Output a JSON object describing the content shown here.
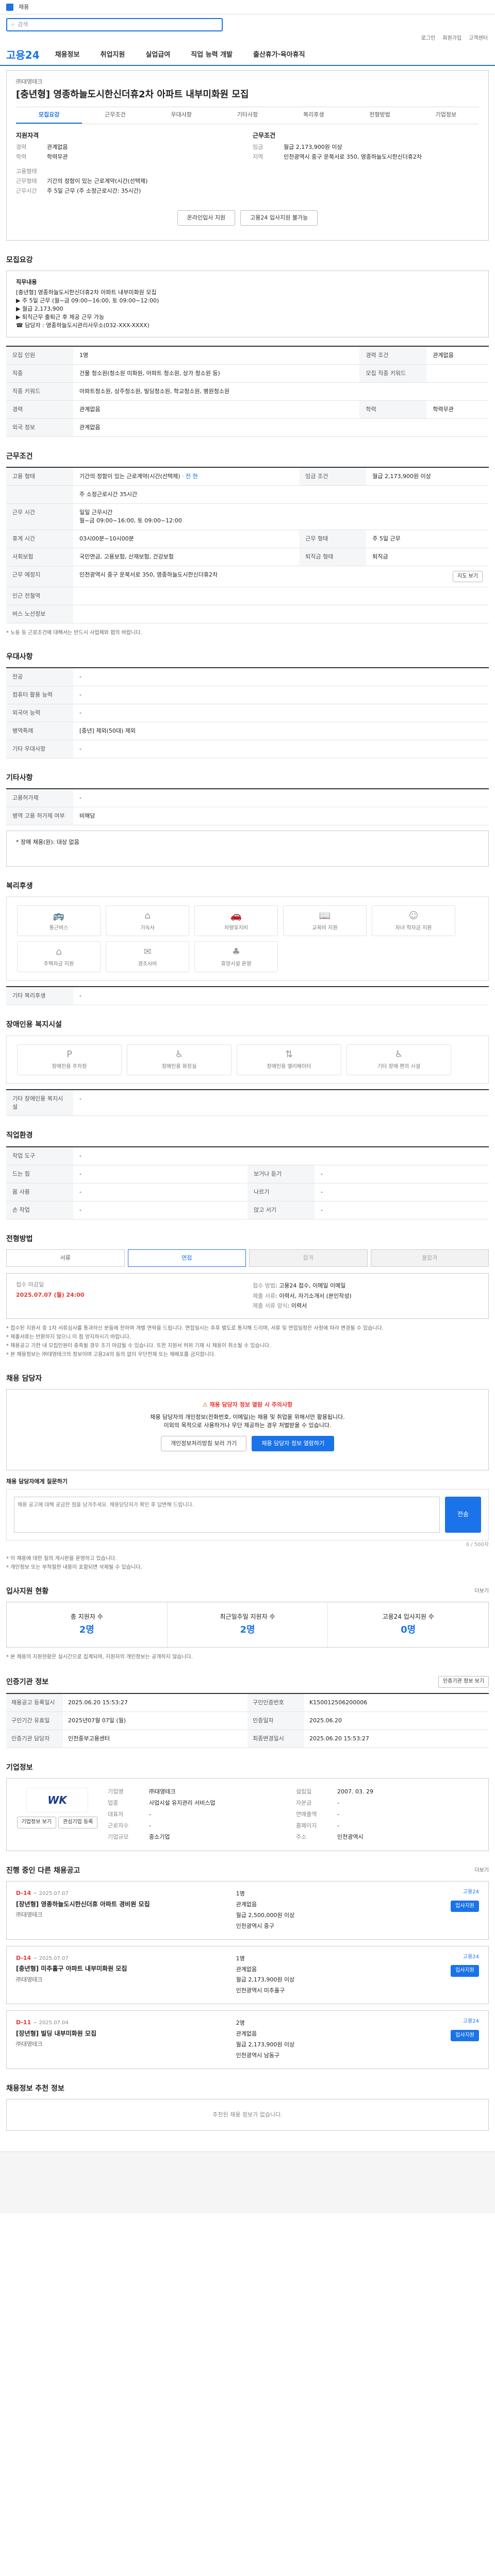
{
  "header": {
    "top_left": "채용",
    "search_placeholder": "검색",
    "util": [
      "로그인",
      "회원가입",
      "고객센터"
    ],
    "brand": "고용24",
    "menu": [
      "채용정보",
      "취업지원",
      "실업급여",
      "직업 능력 개발",
      "출산휴가·육아휴직"
    ]
  },
  "title": {
    "company": "㈜대영테크",
    "heading": "[충년형] 영종하늘도시한신더휴2차 아파트 내부미화원 모집",
    "tabs": [
      "모집요강",
      "근무조건",
      "우대사항",
      "기타사항",
      "복리후생",
      "전형방법",
      "기업정보"
    ],
    "active_tab": 0,
    "left_head": "지원자격",
    "right_head": "근무조건",
    "left_kv": [
      {
        "k": "경력",
        "v": "관계없음"
      },
      {
        "k": "학력",
        "v": "학력무관"
      }
    ],
    "right_kv": [
      {
        "k": "임금",
        "v": "월급 2,173,900원 이상"
      },
      {
        "k": "지역",
        "v": "인천광역시 중구 운북서로 350, 영종하늘도시한신더휴2차"
      }
    ],
    "left_kv2": [
      {
        "k": "고용형태",
        "v": ""
      },
      {
        "k": "근무형태",
        "v": "기간의 정함이 있는 근로계약(시간(선택제)"
      },
      {
        "k": "근무시간",
        "v": "주 5일 근무 (주 소정근로시간: 35시간)"
      }
    ],
    "apply_btn": "온라인입사 지원",
    "scrap_btn": "고용24 입사지원 불가능"
  },
  "recruit": {
    "title": "모집요강",
    "desc": [
      "직무내용",
      "[충년형] 영종하늘도시한신더휴2차 아파트 내부미화원 모집",
      "▶ 주 5일 근무 (월~금 09:00~16:00, 토 09:00~12:00)",
      "▶ 월급 2,173,900",
      "▶ 퇴직근무 출퇴근 후 제공 근무 가능",
      "☎ 담당자 : 영종하늘도시관리사무소(032-XXX-XXXX)"
    ],
    "rows": [
      {
        "k": "모집 인원",
        "v": "1명",
        "k2": "경력 조건",
        "v2": "관계없음"
      },
      {
        "k": "직종",
        "v": "건물 청소원(청소원 미화원, 아파트 청소원, 상가 청소원 등)",
        "k2": "모집 직종 키워드",
        "v2": ""
      },
      {
        "k": "직종 키워드",
        "v": "아파트청소원, 상주청소원, 빌딩청소원, 학교청소원, 병원청소원",
        "k2": "",
        "v2": ""
      },
      {
        "k": "경력",
        "v": "관계없음",
        "k2": "학력",
        "v2": "학력무관"
      },
      {
        "k": "외국 정보",
        "v": "관계없음",
        "k2": "",
        "v2": ""
      }
    ]
  },
  "conditions": {
    "title": "근무조건",
    "rows": [
      {
        "k": "고용 형태",
        "v": "기간의 정함이 있는 근로계약(시간(선택제)",
        "v_extra": "· 전 현",
        "k2": "임금 조건",
        "v2": "월급 2,173,900원 이상"
      },
      {
        "k": "",
        "v": "주 소정근로시간 35시간",
        "v_extra": "",
        "k2": "",
        "v2": ""
      },
      {
        "k": "근무 시간",
        "v": "일일 근무시간",
        "v_extra": "월~금 09:00~16:00, 토 09:00~12:00",
        "k2": "",
        "v2": ""
      },
      {
        "k": "휴게 시간",
        "v": "03시00분~10시00분",
        "v_extra": "",
        "k2": "근무 형태",
        "v2": "주 5일 근무"
      },
      {
        "k": "사회보험",
        "v": "국민연금, 고용보험, 산재보험, 건강보험",
        "v_extra": "",
        "k2": "퇴직금 형태",
        "v2": "퇴직금"
      },
      {
        "k": "근무 예정지",
        "v": "인천광역시 중구 운북서로 350, 영종하늘도시한신더휴2차",
        "v_extra": "",
        "k2": "",
        "v2": ""
      },
      {
        "k": "인근 전철역",
        "v": "",
        "v_extra": "",
        "k2": "",
        "v2": ""
      },
      {
        "k": "버스 노선정보",
        "v": "",
        "v_extra": "",
        "k2": "",
        "v2": ""
      }
    ],
    "map_btn": "지도 보기",
    "note": "* 노동 등 근로조건에 대해서는 반드시 사업체와 협의 바랍니다."
  },
  "preference": {
    "title": "우대사항",
    "rows": [
      {
        "k": "전공",
        "v": "-"
      },
      {
        "k": "컴퓨터 활용 능력",
        "v": "-"
      },
      {
        "k": "외국어 능력",
        "v": "-"
      },
      {
        "k": "병역특례",
        "v": "[중년] 제외(50대) 제외"
      },
      {
        "k": "기타 우대사항",
        "v": "-"
      }
    ]
  },
  "etc": {
    "title": "기타사항",
    "rows": [
      {
        "k": "고용허가제",
        "v": "-"
      },
      {
        "k": "병역 고용 허가제 여부",
        "v": "비해당"
      }
    ],
    "extra": "* 장애 채용(원): 대상 없음"
  },
  "welfare": {
    "title": "복리후생",
    "items": [
      "통근버스",
      "기숙사",
      "차량유지비",
      "교육비 지원",
      "자녀 학자금 지원",
      "주택자금 지원",
      "경조사비",
      "휴양시설 운영"
    ],
    "other_label": "기타 복리후생",
    "other_value": "-"
  },
  "disabled": {
    "title": "장애인용 복지시설",
    "items": [
      "장애인용 주차장",
      "장애인용 화장실",
      "장애인용 엘리베이터",
      "기타 장애 편의 시설"
    ],
    "other_label": "기타 장애인용 복지시설",
    "other_value": "-"
  },
  "selection": {
    "title": "직업환경",
    "rows": [
      {
        "k": "작업 도구",
        "v": "-",
        "k2": "",
        "v2": ""
      },
      {
        "k": "드는 힘",
        "v": "-",
        "k2": "보거나 듣기",
        "v2": "-"
      },
      {
        "k": "몸 사용",
        "v": "-",
        "k2": "나르기",
        "v2": "-"
      },
      {
        "k": "손 작업",
        "v": "-",
        "k2": "앉고 서기",
        "v2": "-"
      }
    ]
  },
  "process": {
    "title": "전형방법",
    "steps": [
      "서류",
      "면접",
      "합격",
      "불합격"
    ],
    "left_head": "접수 마감일",
    "deadline": "2025.07.07 (월) 24:00",
    "receipt_k": "접수 방법",
    "receipt_v": "고용24 접수, 이메일 이메일",
    "docs_k": "제출 서류",
    "docs_v": "이력서, 자기소개서 (본인작성)",
    "form_k": "제출 서류 양식",
    "form_v": "이력서",
    "notes": [
      "* 접수된 지원서 중 1차 서류심사를 통과하신 분들에 한하여 개별 연락을 드립니다. 면접일시는 추후 별도로 통지해 드리며, 서류 및 면접일정은 사정에 따라 변경될 수 있습니다.",
      "* 제출서류는 반환하지 않으니 이 점 양지하시기 바랍니다.",
      "* 채용공고 기한 내 모집인원이 충족될 경우 조기 마감될 수 있습니다. 또한 지원서 허위 기재 시 채용이 취소될 수 있습니다.",
      "* 본 채용정보는 ㈜대영테크의 정보이며 고용24의 동의 없이 무단전재 또는 재배포를 금지합니다."
    ]
  },
  "contact": {
    "title": "채용 담당자",
    "warn": "채용 담당자 정보 열람 시 주의사항",
    "text": "채용 담당자의 개인정보(전화번호, 이메일)는 채용 및 취업을 위해서만 활용됩니다.",
    "text2": "이외의 목적으로 사용하거나 무단 제공하는 경우 처벌받을 수 있습니다.",
    "btn1": "개인정보처리방침 보러 가기",
    "btn2": "채용 담당자 정보 열람하기",
    "inq_label": "채용 담당자에게 질문하기",
    "inq_placeholder": "채용 공고에 대해 궁금한 점을 남겨주세요. 채용담당자가 확인 후 답변해 드립니다.",
    "inq_counter": "0 / 500자",
    "inq_send": "전송",
    "notes": [
      "* 이 채용에 대한 질의 게시판을 운영하고 있습니다.",
      "* 개인정보 또는 부적절한 내용이 포함되면 삭제될 수 있습니다."
    ]
  },
  "stats": {
    "title": "입사지원 현황",
    "more": "더보기",
    "items": [
      {
        "label": "총 지원자 수",
        "value": "2명"
      },
      {
        "label": "최근일주일 지원자 수",
        "value": "2명"
      },
      {
        "label": "고용24 입사지원 수",
        "value": "0명"
      }
    ],
    "note": "* 본 채용의 지원현황은 실시간으로 집계되며, 지원자의 개인정보는 공개하지 않습니다."
  },
  "info": {
    "title": "인증기관 정보",
    "btn": "인증기관 정보 보기",
    "rows": [
      {
        "k": "채용공고 등록일시",
        "v": "2025.06.20 15:53:27",
        "k2": "구인인증번호",
        "v2": "K150012506200006"
      },
      {
        "k": "구인기간 유효일",
        "v": "2025년07월 07일 (월)",
        "k2": "인증일자",
        "v2": "2025.06.20"
      },
      {
        "k": "인증기관 담당자",
        "v": "인천중부고용센터",
        "k2": "최종변경일시",
        "v2": "2025.06.20 15:53:27"
      }
    ]
  },
  "company": {
    "title": "기업정보",
    "logo_text": "WK",
    "btn1": "기업정보 보기",
    "btn2": "관심기업 등록",
    "rows": [
      {
        "k": "기업명",
        "v": "㈜대영테크",
        "k2": "설립일",
        "v2": "2007. 03. 29"
      },
      {
        "k": "업종",
        "v": "사업시설 유지관리 서비스업",
        "k2": "자본금",
        "v2": "-"
      },
      {
        "k": "대표자",
        "v": "-",
        "k2": "연매출액",
        "v2": "-"
      },
      {
        "k": "근로자수",
        "v": "-",
        "k2": "홈페이지",
        "v2": "-"
      },
      {
        "k": "기업규모",
        "v": "중소기업",
        "k2": "주소",
        "v2": "인천광역시"
      }
    ]
  },
  "jobs": {
    "title": "진행 중인 다른 채용공고",
    "more": "더보기",
    "items": [
      {
        "dday": "D-14",
        "date": "~ 2025.07.07",
        "title": "[장년형] 영종하늘도시한신더휴 아파트 경비원 모집",
        "company": "㈜대영테크",
        "m1": "1명",
        "m2": "관계없음",
        "m3": "월급 2,500,000원 이상",
        "m4": "인천광역시 중구",
        "btn": "입사지원",
        "emblem": "고용24"
      },
      {
        "dday": "D-14",
        "date": "~ 2025.07.07",
        "title": "[충년형] 미추홀구 아파트 내부미화원 모집",
        "company": "㈜대영테크",
        "m1": "1명",
        "m2": "관계없음",
        "m3": "월급 2,173,900원 이상",
        "m4": "인천광역시 미추홀구",
        "btn": "입사지원",
        "emblem": "고용24"
      },
      {
        "dday": "D-11",
        "date": "~ 2025.07.04",
        "title": "[장년형] 빌딩 내부미화원 모집",
        "company": "㈜대영테크",
        "m1": "2명",
        "m2": "관계없음",
        "m3": "월급 2,173,900원 이상",
        "m4": "인천광역시 남동구",
        "btn": "입사지원",
        "emblem": "고용24"
      }
    ]
  },
  "recent": {
    "title": "채용정보 추천 정보",
    "empty": "추천된 채용 정보가 없습니다."
  }
}
